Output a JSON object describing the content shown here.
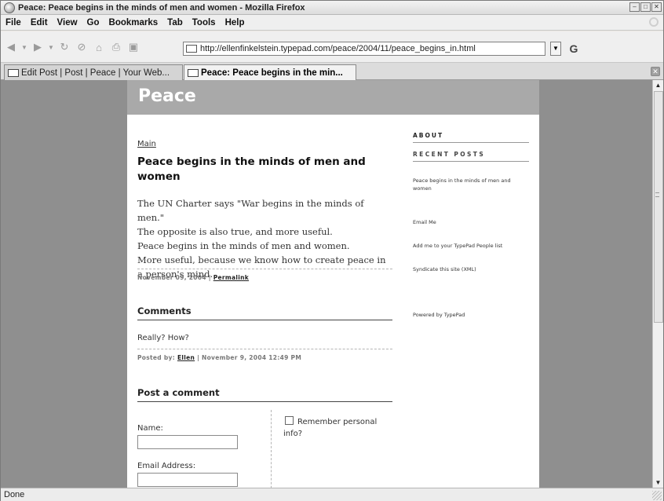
{
  "window": {
    "title": "Peace: Peace begins in the minds of men and women - Mozilla Firefox",
    "controls": [
      "–",
      "□",
      "✕"
    ]
  },
  "menu": [
    "File",
    "Edit",
    "View",
    "Go",
    "Bookmarks",
    "Tab",
    "Tools",
    "Help"
  ],
  "toolbar": {
    "url": "http://ellenfinkelstein.typepad.com/peace/2004/11/peace_begins_in.html",
    "icons": [
      "back-icon",
      "forward-icon",
      "reload-icon",
      "stop-icon",
      "home-icon",
      "print-icon",
      "print-preview-icon"
    ]
  },
  "tabs": [
    {
      "label": "Edit Post | Post | Peace | Your Web...",
      "active": false
    },
    {
      "label": "Peace: Peace begins in the min...",
      "active": true
    }
  ],
  "page": {
    "blog_title": "Peace",
    "main_link": "Main",
    "post": {
      "title": "Peace begins in the minds of men and women",
      "lines": [
        "The UN Charter says \"War begins in the minds of men.\"",
        "The opposite is also true, and more useful.",
        "Peace begins in the minds of men and women.",
        "More useful, because we know how to create peace in a person's mind."
      ],
      "date": "November 09, 2004",
      "separator": "|",
      "permalink": "Permalink"
    },
    "comments": {
      "heading": "Comments",
      "items": [
        {
          "text": "Really? How?",
          "posted_by": "Posted by:",
          "author": "Ellen",
          "date": "| November 9, 2004 12:49 PM"
        }
      ]
    },
    "post_comment": {
      "heading": "Post a comment",
      "name_label": "Name:",
      "name_value": "",
      "email_label": "Email Address:",
      "email_value": "",
      "remember_label": "Remember personal info?",
      "remember_checked": false
    },
    "sidebar": {
      "about": "ABOUT",
      "recent_posts": "RECENT POSTS",
      "recent_items": [
        "Peace begins in the minds of men and women"
      ],
      "links": [
        "Email Me",
        "Add me to your TypePad People list",
        "Syndicate this site (XML)"
      ],
      "powered_by": "Powered by TypePad"
    }
  },
  "status": {
    "text": "Done"
  }
}
